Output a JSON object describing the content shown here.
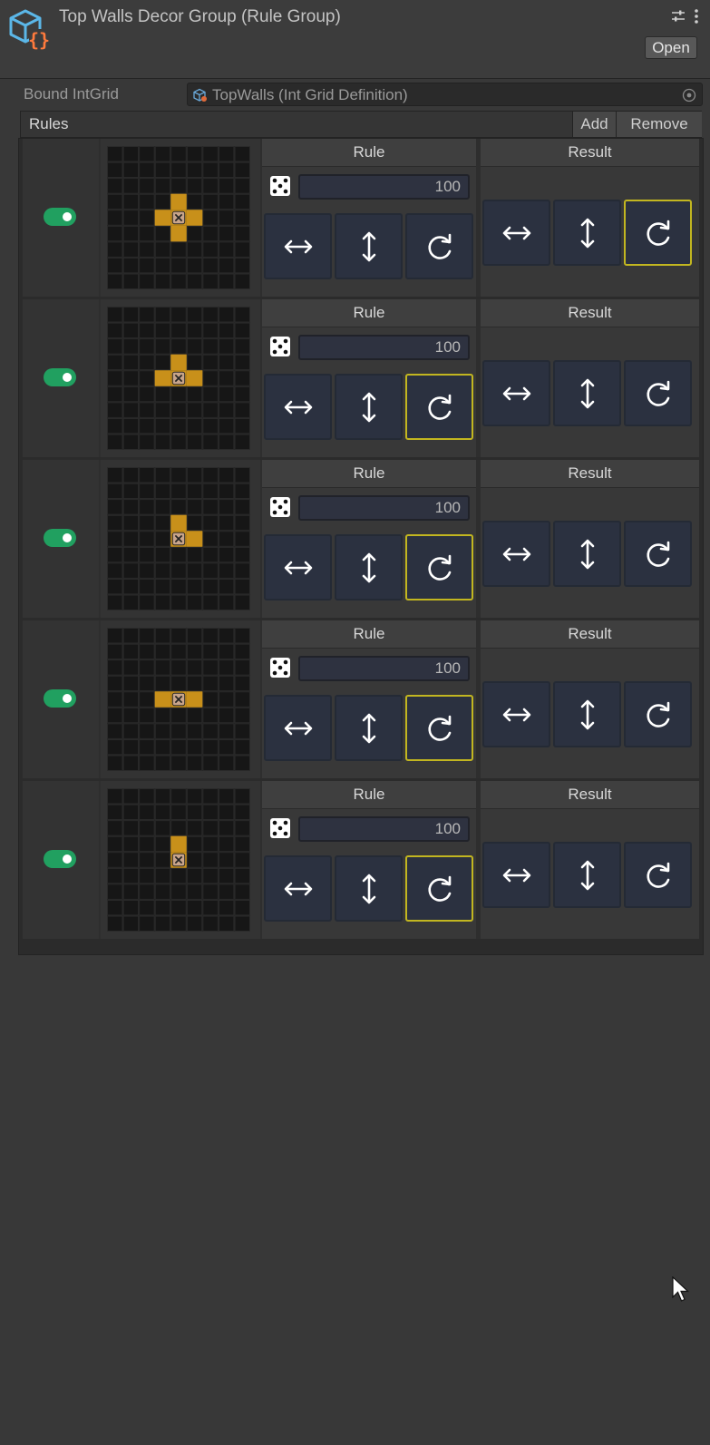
{
  "header": {
    "title": "Top Walls Decor Group (Rule Group)",
    "open_label": "Open",
    "icon": "rule-group-asset-icon"
  },
  "bound": {
    "label": "Bound IntGrid",
    "value": "TopWalls (Int Grid Definition)"
  },
  "rules_section": {
    "label": "Rules",
    "add_label": "Add",
    "remove_label": "Remove"
  },
  "colors": {
    "accent_active": "#c2b620",
    "toggle_on": "#21a060",
    "pattern_tile": "#c8901a",
    "center_tile": "#c8a48a"
  },
  "rules": [
    {
      "enabled": true,
      "rule_title": "Rule",
      "result_title": "Result",
      "chance": "100",
      "pattern": [
        [
          0,
          -1
        ],
        [
          -1,
          0
        ],
        [
          1,
          0
        ],
        [
          0,
          1
        ]
      ],
      "rule_transforms": {
        "flip_x": false,
        "flip_y": false,
        "rotate": false
      },
      "result_transforms": {
        "flip_x": false,
        "flip_y": false,
        "rotate": true
      }
    },
    {
      "enabled": true,
      "rule_title": "Rule",
      "result_title": "Result",
      "chance": "100",
      "pattern": [
        [
          0,
          -1
        ],
        [
          -1,
          0
        ],
        [
          1,
          0
        ]
      ],
      "rule_transforms": {
        "flip_x": false,
        "flip_y": false,
        "rotate": true
      },
      "result_transforms": {
        "flip_x": false,
        "flip_y": false,
        "rotate": false
      }
    },
    {
      "enabled": true,
      "rule_title": "Rule",
      "result_title": "Result",
      "chance": "100",
      "pattern": [
        [
          0,
          -1
        ],
        [
          1,
          0
        ]
      ],
      "rule_transforms": {
        "flip_x": false,
        "flip_y": false,
        "rotate": true
      },
      "result_transforms": {
        "flip_x": false,
        "flip_y": false,
        "rotate": false
      }
    },
    {
      "enabled": true,
      "rule_title": "Rule",
      "result_title": "Result",
      "chance": "100",
      "pattern": [
        [
          -1,
          0
        ],
        [
          1,
          0
        ]
      ],
      "rule_transforms": {
        "flip_x": false,
        "flip_y": false,
        "rotate": true
      },
      "result_transforms": {
        "flip_x": false,
        "flip_y": false,
        "rotate": false
      }
    },
    {
      "enabled": true,
      "rule_title": "Rule",
      "result_title": "Result",
      "chance": "100",
      "pattern": [
        [
          0,
          -1
        ]
      ],
      "rule_transforms": {
        "flip_x": false,
        "flip_y": false,
        "rotate": true
      },
      "result_transforms": {
        "flip_x": false,
        "flip_y": false,
        "rotate": false
      }
    }
  ]
}
